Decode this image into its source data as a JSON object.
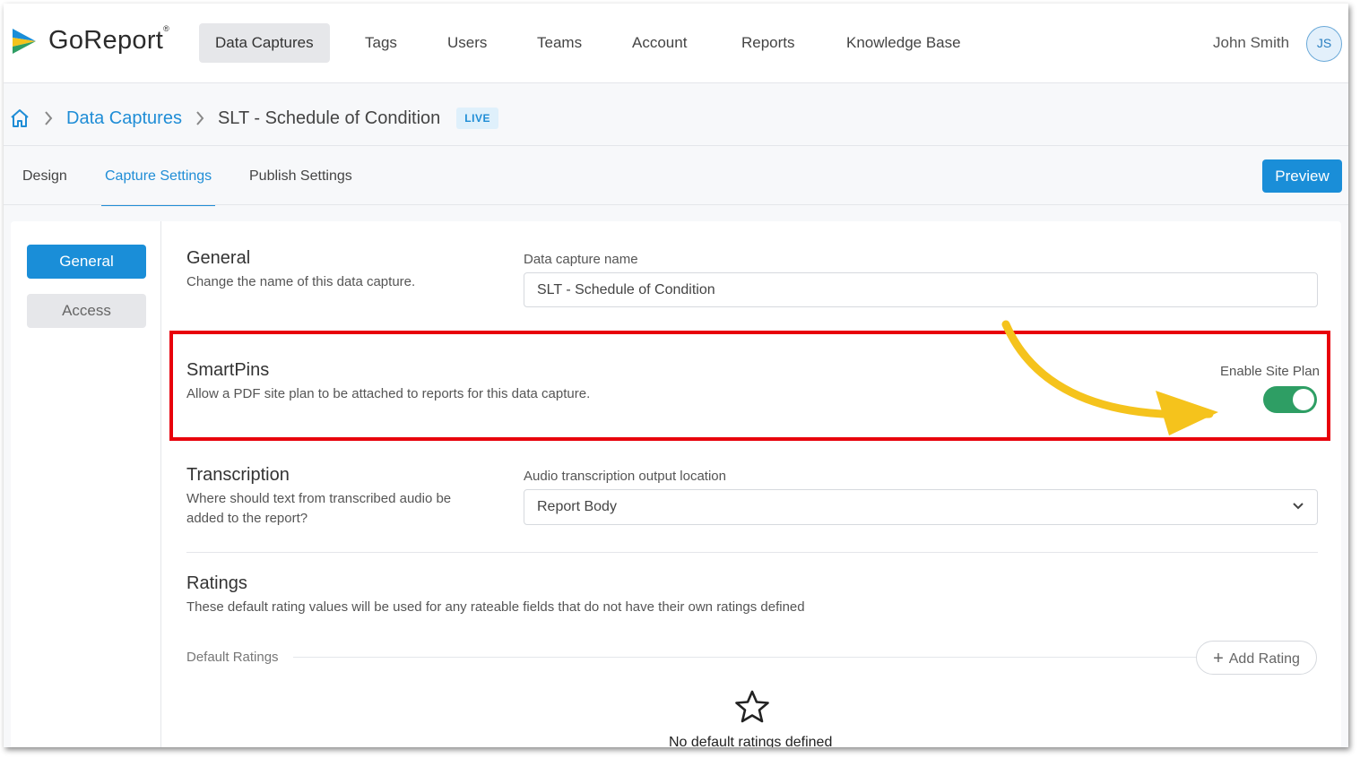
{
  "brand": {
    "name": "GoReport",
    "reg_mark": "®"
  },
  "nav": {
    "items": [
      {
        "label": "Data Captures",
        "active": true
      },
      {
        "label": "Tags"
      },
      {
        "label": "Users"
      },
      {
        "label": "Teams"
      },
      {
        "label": "Account"
      },
      {
        "label": "Reports"
      },
      {
        "label": "Knowledge Base"
      }
    ],
    "user_name": "John Smith",
    "avatar_initials": "JS"
  },
  "breadcrumb": {
    "home_icon": "home-icon",
    "link": "Data Captures",
    "current": "SLT - Schedule of Condition",
    "badge": "LIVE"
  },
  "tabs": [
    {
      "label": "Design"
    },
    {
      "label": "Capture Settings",
      "active": true
    },
    {
      "label": "Publish Settings"
    }
  ],
  "preview_label": "Preview",
  "sidebar": {
    "items": [
      {
        "label": "General",
        "active": true
      },
      {
        "label": "Access"
      }
    ]
  },
  "general": {
    "title": "General",
    "desc": "Change the name of this data capture.",
    "field_label": "Data capture name",
    "field_value": "SLT - Schedule of Condition"
  },
  "smartpins": {
    "title": "SmartPins",
    "desc": "Allow a PDF site plan to be attached to reports for this data capture.",
    "toggle_label": "Enable Site Plan",
    "enabled": true
  },
  "transcription": {
    "title": "Transcription",
    "desc_line1": "Where should text from transcribed audio be",
    "desc_line2": "added to the report?",
    "field_label": "Audio transcription output location",
    "selected": "Report Body"
  },
  "ratings": {
    "title": "Ratings",
    "desc": "These default rating values will be used for any rateable fields that do not have their own ratings defined",
    "default_label": "Default Ratings",
    "add_label": "Add Rating",
    "empty_text": "No default ratings defined"
  },
  "colors": {
    "accent": "#1a8ed8",
    "highlight": "#e8000b",
    "toggle_on": "#2e9e64",
    "arrow": "#f5c31c"
  }
}
